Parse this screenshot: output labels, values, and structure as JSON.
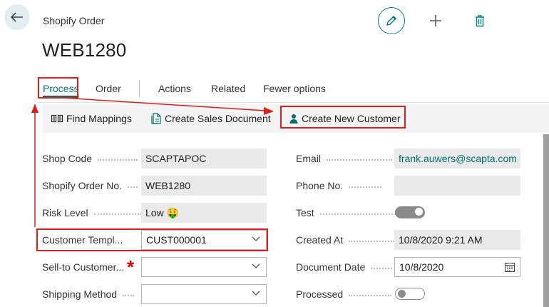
{
  "header": {
    "caption": "Shopify Order",
    "title": "WEB1280"
  },
  "menu": {
    "items": [
      "Process",
      "Order",
      "Actions",
      "Related",
      "Fewer options"
    ]
  },
  "toolbar": {
    "find_mappings": "Find Mappings",
    "create_sales_document": "Create Sales Document",
    "create_new_customer": "Create New Customer"
  },
  "form": {
    "left": [
      {
        "label": "Shop Code",
        "value": "SCAPTAPOC"
      },
      {
        "label": "Shopify Order No.",
        "value": "WEB1280"
      },
      {
        "label": "Risk Level",
        "value": "Low",
        "emoji": "🤑"
      },
      {
        "label": "Customer Templ...",
        "value": "CUST000001"
      },
      {
        "label": "Sell-to Customer...",
        "value": "",
        "required_mark": "*"
      },
      {
        "label": "Shipping Method",
        "value": ""
      }
    ],
    "right": [
      {
        "label": "Email",
        "value": "frank.auwers@scapta.com"
      },
      {
        "label": "Phone No.",
        "value": ""
      },
      {
        "label": "Test",
        "toggle": true
      },
      {
        "label": "Created At",
        "value": "10/8/2020 9:21 AM"
      },
      {
        "label": "Document Date",
        "value": "10/8/2020"
      },
      {
        "label": "Processed",
        "toggle": false
      }
    ]
  },
  "colors": {
    "accent": "#00716c",
    "highlight": "#d9201c",
    "required": "#e00000"
  },
  "icons": [
    "back-arrow-icon",
    "edit-pencil-icon",
    "plus-icon",
    "trash-icon",
    "mappings-icon",
    "sales-document-icon",
    "person-icon",
    "chevron-down-icon",
    "calendar-icon"
  ]
}
